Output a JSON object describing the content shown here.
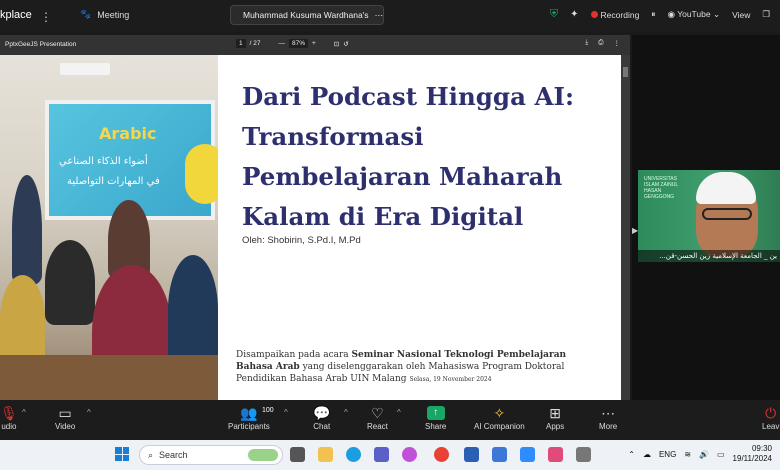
{
  "topbar": {
    "app_title": "kplace",
    "meeting_label": "Meeting",
    "host_name": "Muhammad Kusuma Wardhana's",
    "recording_label": "Recording",
    "youtube_label": "YouTube",
    "view_label": "View"
  },
  "pdf": {
    "file_name": "PptxGeeJS Presentation",
    "page_current": "1",
    "page_total": "/ 27",
    "zoom_level": "87%",
    "zoom_out": "—",
    "zoom_in": "+"
  },
  "slide": {
    "title": "Dari Podcast Hingga AI: Transformasi Pembelajaran Maharah Kalam di Era Digital",
    "author": "Oleh: Shobirin, S.Pd.I, M.Pd",
    "desc_prefix": "Disampaikan pada acara ",
    "desc_event": "Seminar Nasional Teknologi Pembelajaran Bahasa Arab",
    "desc_suffix": " yang diselenggarakan oleh Mahasiswa Program Doktoral Pendidikan Bahasa Arab UIN Malang",
    "desc_date": "Selasa, 19 November 2024",
    "photo_board_word": "Arabic",
    "photo_board_line1": "أضواء الذكاء الصناعي",
    "photo_board_line2": "في المهارات التواصلية"
  },
  "participant": {
    "name_label": "...ين _ الجامعة الإسلامية زين الحسن-قن",
    "logo_text": "UNIVERSITAS ISLAM ZAINUL HASAN GENGGONG"
  },
  "controls": {
    "audio_label": "udio",
    "video_label": "Video",
    "participants_label": "Participants",
    "participants_count": "100",
    "chat_label": "Chat",
    "react_label": "React",
    "share_label": "Share",
    "companion_label": "AI Companion",
    "apps_label": "Apps",
    "more_label": "More",
    "leave_label": "Leav"
  },
  "taskbar": {
    "search_placeholder": "Search",
    "lang": "ENG",
    "time": "09:30",
    "date": "19/11/2024"
  },
  "colors": {
    "slide_title": "#2e2f6e",
    "share_green": "#19a667",
    "recording_red": "#e0332e"
  }
}
